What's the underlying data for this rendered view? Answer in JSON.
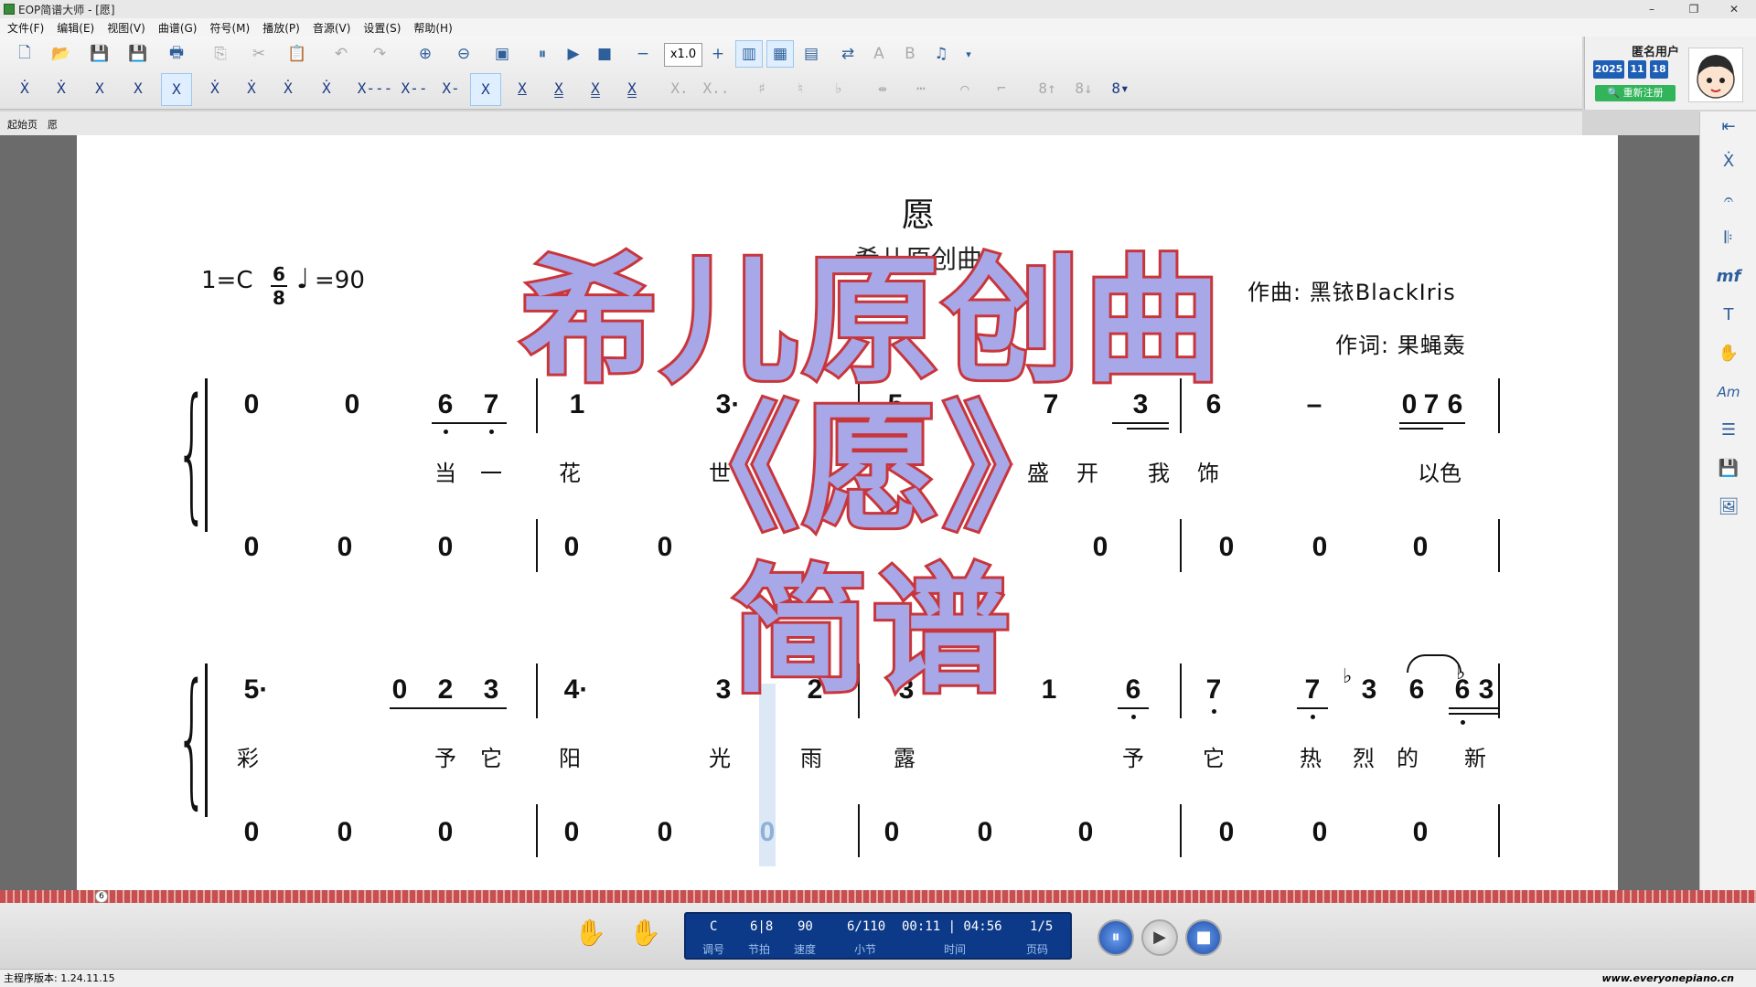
{
  "window": {
    "title": "EOP简谱大师 - [愿]"
  },
  "menu": [
    "文件(F)",
    "编辑(E)",
    "视图(V)",
    "曲谱(G)",
    "符号(M)",
    "播放(P)",
    "音源(V)",
    "设置(S)",
    "帮助(H)"
  ],
  "toolbar": {
    "speed": "x1.0"
  },
  "user": {
    "name": "匿名用户",
    "year": "2025",
    "month": "11",
    "day": "18",
    "register": "重新注册"
  },
  "tabs": [
    "起始页",
    "愿"
  ],
  "score": {
    "title": "愿",
    "subtitle": "希儿原创曲",
    "key_sig": "1=C",
    "time_top": "6",
    "time_bottom": "8",
    "tempo": "=90",
    "composer": "作曲: 黑铱BlackIris",
    "lyricist": "作词: 果蝇轰",
    "sys1_melody": [
      "0",
      "0",
      "6",
      "7",
      "1",
      "3·",
      "5·",
      "7",
      "1",
      "3",
      "6",
      "–",
      "0",
      "7",
      "6"
    ],
    "sys1_lyrics": [
      "当",
      "一",
      "花",
      "世",
      "盛",
      "开",
      "我",
      "饰",
      "以色"
    ],
    "sys1_bass": [
      "0",
      "0",
      "0",
      "0",
      "0",
      "0",
      "0",
      "0",
      "0"
    ],
    "sys2_melody": [
      "5·",
      "0",
      "2",
      "3",
      "4·",
      "3",
      "2",
      "3",
      "1",
      "6",
      "7",
      "7",
      "3",
      "6",
      "6",
      "3"
    ],
    "sys2_lyrics": [
      "彩",
      "予",
      "它",
      "阳",
      "光",
      "雨",
      "露",
      "予",
      "它",
      "热",
      "烈",
      "的",
      "新"
    ],
    "sys2_bass": [
      "0",
      "0",
      "0",
      "0",
      "0",
      "0",
      "0",
      "0",
      "0",
      "0",
      "0",
      "0"
    ]
  },
  "overlay": {
    "line1": "希儿原创曲",
    "line2": "《愿》",
    "line3": "简谱"
  },
  "player": {
    "key": "C",
    "meter": "6|8",
    "speed": "90",
    "measure": "6/110",
    "time": "00:11 | 04:56",
    "page": "1/5",
    "key_label": "调号",
    "meter_label": "节拍",
    "speed_label": "速度",
    "measure_label": "小节",
    "time_label": "时间",
    "page_label": "页码"
  },
  "status": {
    "version": "主程序版本: 1.24.11.15",
    "website": "www.everyonepiano.cn"
  },
  "ruler": {
    "marker": "6"
  }
}
